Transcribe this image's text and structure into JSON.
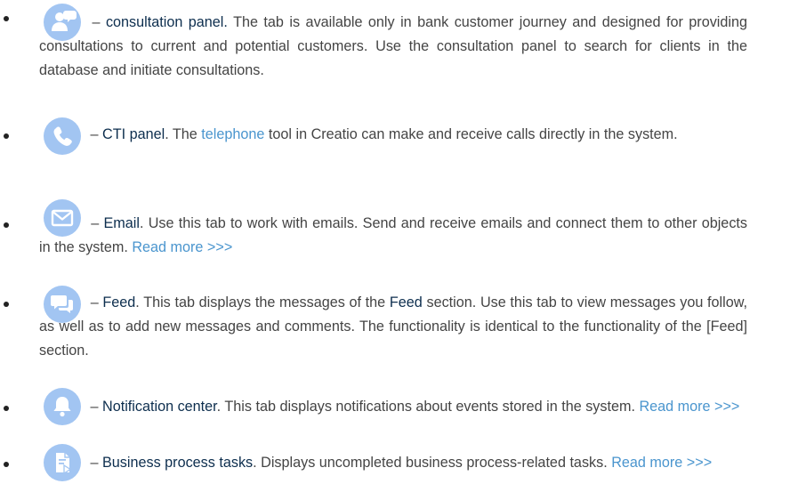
{
  "colors": {
    "icon_bg": "#a2c5f2",
    "term": "#0d2e4e",
    "link": "#4a95ce",
    "text": "#444444"
  },
  "items": [
    {
      "icon": "consultation-icon",
      "term": "consultation panel.",
      "body": " The tab is available only in bank customer journey and designed for providing consultations to current and potential customers. Use the consultation panel to search for clients in the database and initiate consultations."
    },
    {
      "icon": "phone-icon",
      "term": "CTI panel",
      "body_before": ". The ",
      "link": "telephone",
      "body_after": " tool in Creatio can make and receive calls directly in the system."
    },
    {
      "icon": "email-icon",
      "term": "Email",
      "body": ". Use this tab to work with emails. Send and receive emails and connect them to other objects in the system. ",
      "link": "Read more >>>"
    },
    {
      "icon": "feed-icon",
      "term": "Feed",
      "body_before": ". This tab displays the messages of the ",
      "term2": "Feed",
      "body_after": " section. Use this tab to view messages you follow, as well as to add new messages and comments. The functionality is identical to the functionality of the [Feed] section."
    },
    {
      "icon": "bell-icon",
      "term": "Notification center",
      "body": ". This tab displays notifications about events stored in the system. ",
      "link": "Read more >>>"
    },
    {
      "icon": "task-icon",
      "term": "Business process tasks",
      "body": ". Displays uncompleted business process-related tasks. ",
      "link": "Read more >>>"
    }
  ],
  "dash": " – "
}
